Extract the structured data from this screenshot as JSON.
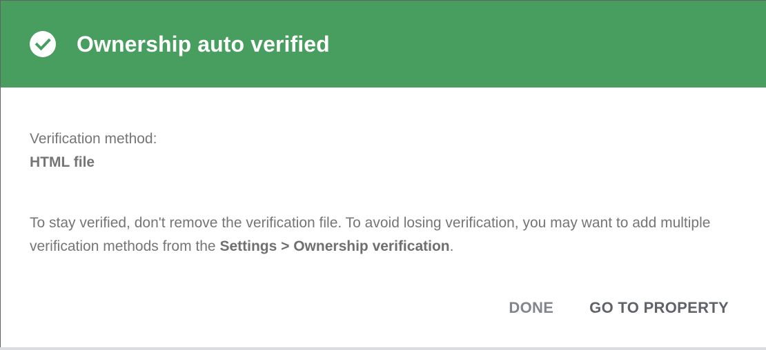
{
  "dialog": {
    "title": "Ownership auto verified",
    "header_color": "#489e5e",
    "header_icon": "check-circle-icon",
    "method_label": "Verification method:",
    "method_value": "HTML file",
    "info_text_prefix": "To stay verified, don't remove the verification file. To avoid losing verification, you may want to add multiple verification methods from the ",
    "info_text_link": "Settings > Ownership verification",
    "info_text_suffix": ".",
    "actions": {
      "done_label": "DONE",
      "go_to_property_label": "GO TO PROPERTY"
    }
  }
}
